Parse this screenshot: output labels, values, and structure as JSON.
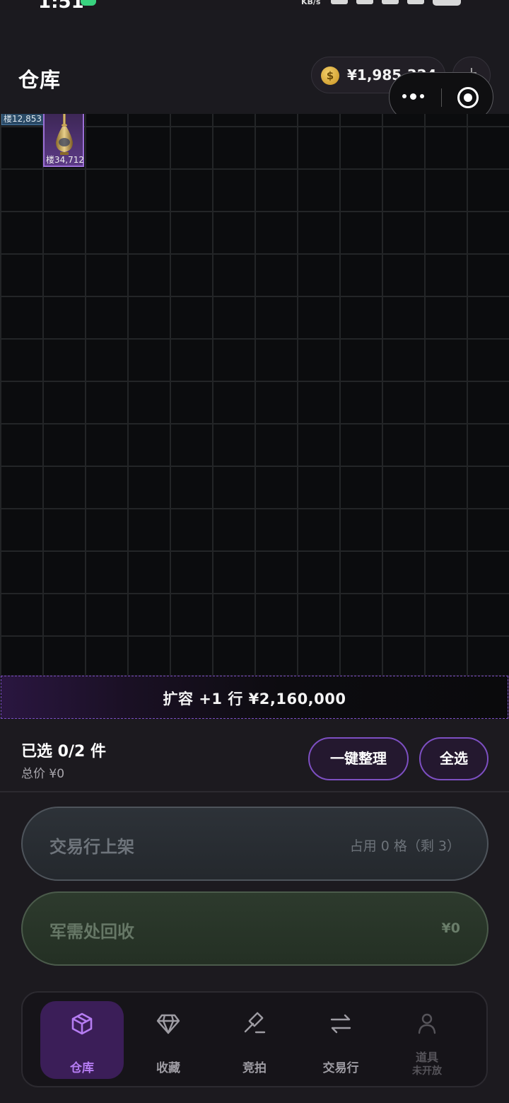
{
  "status_bar": {
    "time": "1:51",
    "speed_unit": "KB/s"
  },
  "header": {
    "title": "仓库",
    "currency_symbol": "$",
    "currency_value": "¥1,985,324",
    "add_label": "+"
  },
  "grid": {
    "items": [
      {
        "label": "楼12,853",
        "rarity_color": "#4f7fa8"
      },
      {
        "label": "楼34,712",
        "rarity_color": "#9b6fd6",
        "icon": "vase-icon"
      }
    ]
  },
  "expand": {
    "label": "扩容 +1 行  ¥2,160,000"
  },
  "selection": {
    "count_label": "已选 0/2 件",
    "total_label": "总价  ¥0",
    "sort_button": "一键整理",
    "select_all_button": "全选"
  },
  "actions": {
    "market": {
      "label": "交易行上架",
      "info": "占用 0 格（剩 3）"
    },
    "recycle": {
      "label": "军需处回收",
      "info": "¥0"
    }
  },
  "nav": {
    "items": [
      {
        "label": "仓库",
        "icon": "box-icon",
        "active": true
      },
      {
        "label": "收藏",
        "icon": "diamond-icon",
        "active": false
      },
      {
        "label": "竞拍",
        "icon": "gavel-icon",
        "active": false
      },
      {
        "label": "交易行",
        "icon": "swap-icon",
        "active": false
      },
      {
        "label": "道具",
        "sub": "未开放",
        "icon": "person-icon",
        "active": false
      }
    ]
  },
  "colors": {
    "accent": "#9b6fd6",
    "active_nav_bg": "#3b1e58"
  }
}
